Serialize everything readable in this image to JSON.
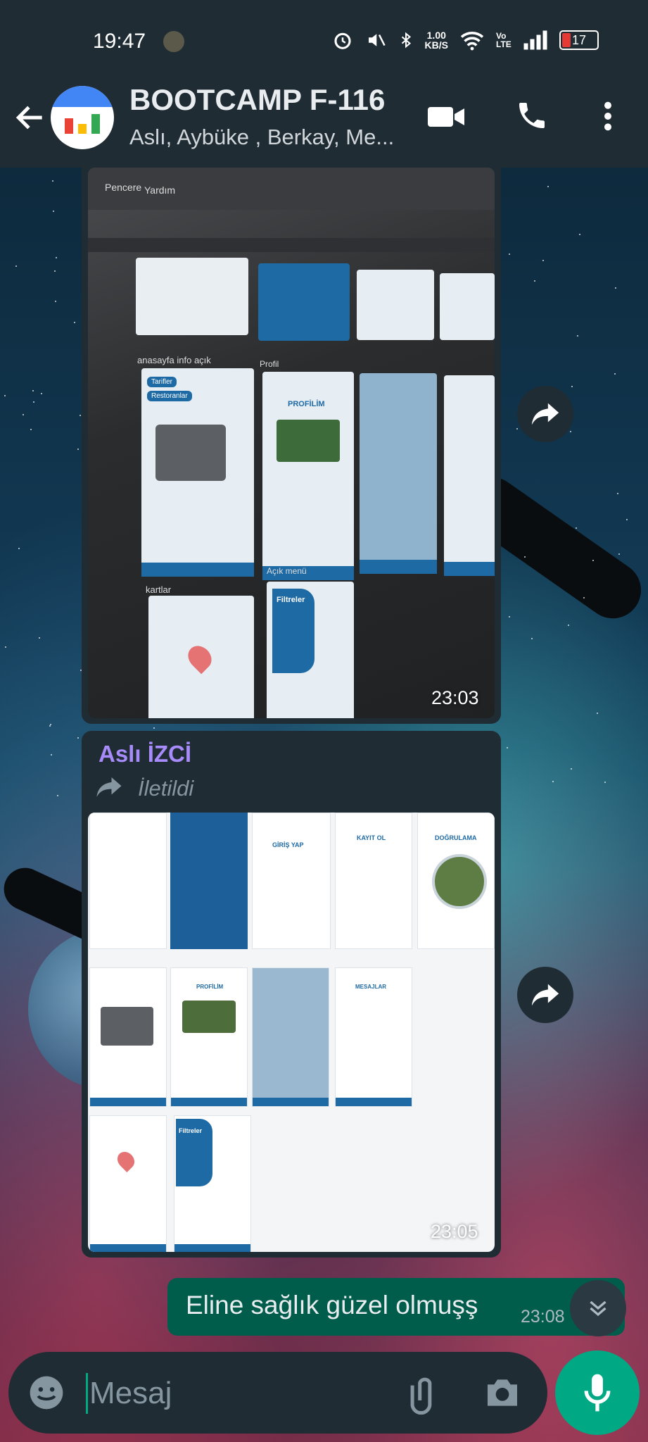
{
  "status_bar": {
    "time": "19:47",
    "net_speed_top": "1.00",
    "net_speed_bottom": "KB/S",
    "volte": "Vo LTE",
    "battery": "17"
  },
  "header": {
    "title": "BOOTCAMP F-116",
    "subtitle": "Aslı, Aybüke , Berkay, Me..."
  },
  "messages": [
    {
      "type": "image",
      "timestamp": "23:03",
      "photo_labels": {
        "menu_pencere": "Pencere",
        "menu_yardim": "Yardım",
        "section_anasayfa": "anasayfa info açık",
        "section_profil": "Profil",
        "section_kartlar": "kartlar",
        "section_acik_menu": "Açık menü",
        "tarifler": "Tarifler",
        "restoranlar": "Restoranlar",
        "profilim": "PROFİLİM",
        "filtreler": "Filtreler"
      }
    },
    {
      "type": "image",
      "sender": "Aslı İZCİ",
      "forwarded_label": "İletildi",
      "timestamp": "23:05",
      "grid_labels": {
        "giris_yap": "GİRİŞ YAP",
        "kayit_ol": "KAYIT OL",
        "dogrulama": "DOĞRULAMA",
        "profilim": "PROFİLİM",
        "mesajlar": "MESAJLAR",
        "filtreler": "Filtreler"
      }
    },
    {
      "type": "text",
      "direction": "outgoing",
      "text": "Eline sağlık güzel olmuşş",
      "timestamp": "23:08"
    }
  ],
  "composer": {
    "placeholder": "Mesaj"
  },
  "colors": {
    "header_bg": "#1f2c34",
    "outgoing_bubble": "#005c4b",
    "accent": "#00a884",
    "sender_name": "#a78bfa"
  }
}
